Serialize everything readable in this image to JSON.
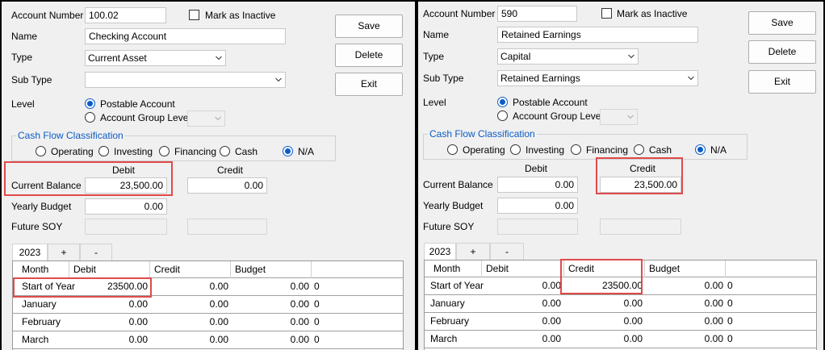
{
  "colors": {
    "highlight": "#e04a4a",
    "accent": "#0a5cc9",
    "group_title": "#0b5cc6"
  },
  "labels": {
    "account_number": "Account Number",
    "mark_inactive": "Mark as Inactive",
    "name": "Name",
    "type": "Type",
    "sub_type": "Sub Type",
    "level": "Level",
    "postable_account": "Postable Account",
    "account_group_level": "Account Group Level",
    "cash_flow_classification": "Cash Flow Classification",
    "operating": "Operating",
    "investing": "Investing",
    "financing": "Financing",
    "cash": "Cash",
    "na": "N/A",
    "debit": "Debit",
    "credit": "Credit",
    "current_balance": "Current Balance",
    "yearly_budget": "Yearly Budget",
    "future_soy": "Future SOY",
    "save": "Save",
    "delete": "Delete",
    "exit": "Exit",
    "tab_plus": "+",
    "tab_minus": "-"
  },
  "grid_headers": [
    "Month",
    "Debit",
    "Credit",
    "Budget"
  ],
  "left": {
    "account_number": "100.02",
    "name": "Checking Account",
    "type": "Current Asset",
    "sub_type": "",
    "year_tab": "2023",
    "current_balance_debit": "23,500.00",
    "current_balance_credit": "0.00",
    "yearly_budget": "0.00",
    "rows": [
      {
        "month": "Start of Year",
        "debit": "23500.00",
        "credit": "0.00",
        "budget": "0.00",
        "extra": "0"
      },
      {
        "month": "January",
        "debit": "0.00",
        "credit": "0.00",
        "budget": "0.00",
        "extra": "0"
      },
      {
        "month": "February",
        "debit": "0.00",
        "credit": "0.00",
        "budget": "0.00",
        "extra": "0"
      },
      {
        "month": "March",
        "debit": "0.00",
        "credit": "0.00",
        "budget": "0.00",
        "extra": "0"
      }
    ]
  },
  "right": {
    "account_number": "590",
    "name": "Retained Earnings",
    "type": "Capital",
    "sub_type": "Retained Earnings",
    "year_tab": "2023",
    "current_balance_debit": "0.00",
    "current_balance_credit": "23,500.00",
    "yearly_budget": "0.00",
    "rows": [
      {
        "month": "Start of Year",
        "debit": "0.00",
        "credit": "23500.00",
        "budget": "0.00",
        "extra": "0"
      },
      {
        "month": "January",
        "debit": "0.00",
        "credit": "0.00",
        "budget": "0.00",
        "extra": "0"
      },
      {
        "month": "February",
        "debit": "0.00",
        "credit": "0.00",
        "budget": "0.00",
        "extra": "0"
      },
      {
        "month": "March",
        "debit": "0.00",
        "credit": "0.00",
        "budget": "0.00",
        "extra": "0"
      }
    ]
  }
}
